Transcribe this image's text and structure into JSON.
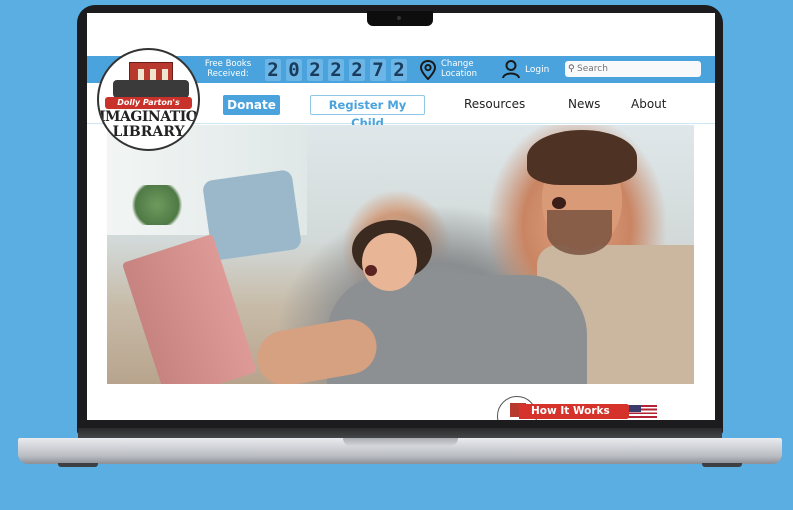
{
  "site": {
    "logo": {
      "line_script": "Dolly Parton's",
      "line1": "IMAGINATION",
      "line2": "LIBRARY"
    }
  },
  "topbar": {
    "free_books_label": "Free Books Received:",
    "counter_digits": [
      "2",
      "0",
      "2",
      "2",
      "2",
      "7",
      "2"
    ],
    "location_label": "Change Location",
    "login_label": "Login",
    "search_placeholder": "Search"
  },
  "nav": {
    "donate_label": "Donate",
    "register_label": "Register My Child",
    "items": [
      "Resources",
      "News",
      "About"
    ]
  },
  "how_it_works": {
    "label": "How It Works"
  },
  "colors": {
    "brand_blue": "#4aa3dd",
    "brand_red": "#d4322a",
    "background": "#5aaee2"
  },
  "icons": {
    "location": "location-pin-icon",
    "user": "user-icon",
    "search": "search-icon",
    "flag": "us-flag-icon"
  }
}
